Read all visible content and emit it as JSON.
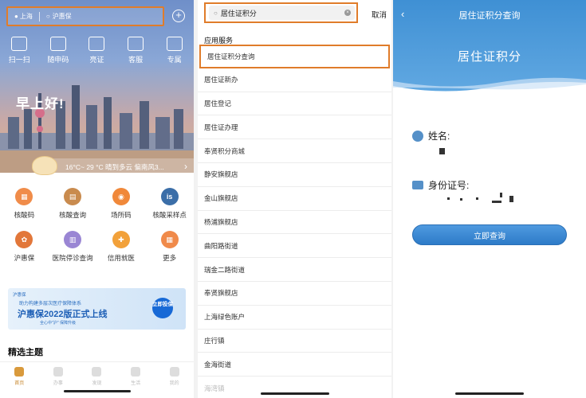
{
  "panel1": {
    "location": "上海",
    "search_placeholder": "沪惠保",
    "quick_actions": [
      "扫一扫",
      "随申码",
      "亮证",
      "客服",
      "专属"
    ],
    "greeting": "早上好!",
    "weather": "16°C~ 29 °C 晴到多云 偏南风3...",
    "services": [
      "核酸码",
      "核酸查询",
      "场所码",
      "核酸采样点",
      "沪惠保",
      "医院停诊查询",
      "信用就医",
      "更多"
    ],
    "service_colors": [
      "#f08c4a",
      "#e08b3a",
      "#f0883a",
      "#3b6ea8",
      "#e2773a",
      "#9a86d4",
      "#f2a13a",
      "#f08a4a"
    ],
    "banner": {
      "brand": "沪惠保",
      "line1": "助力构建多层次医疗保障体系",
      "headline": "沪惠保2022版正式上线",
      "line2": "全心中\"沪\" 保障升级",
      "badge": "立即投保"
    },
    "section_title": "精选主题",
    "tabs": [
      "首页",
      "办事",
      "发现",
      "生活",
      "我的"
    ],
    "active_tab": "首页",
    "accent_color": "#e07c2a"
  },
  "panel2": {
    "search_value": "居住证积分",
    "cancel_label": "取消",
    "category": "应用服务",
    "results": [
      "居住证积分查询",
      "居住证新办",
      "居住登记",
      "居住证办理",
      "奉贤积分商城",
      "静安旗舰店",
      "金山旗舰店",
      "杨浦旗舰店",
      "曲阳路街道",
      "瑞金二路街道",
      "奉贤旗舰店",
      "上海绿色账户",
      "庄行镇",
      "金海街道",
      "海湾镇"
    ]
  },
  "panel3": {
    "nav_title": "居住证积分查询",
    "hero_title": "居住证积分",
    "name_label": "姓名:",
    "id_label": "身份证号:",
    "query_button": "立即查询",
    "brand_color": "#3f90d4"
  }
}
